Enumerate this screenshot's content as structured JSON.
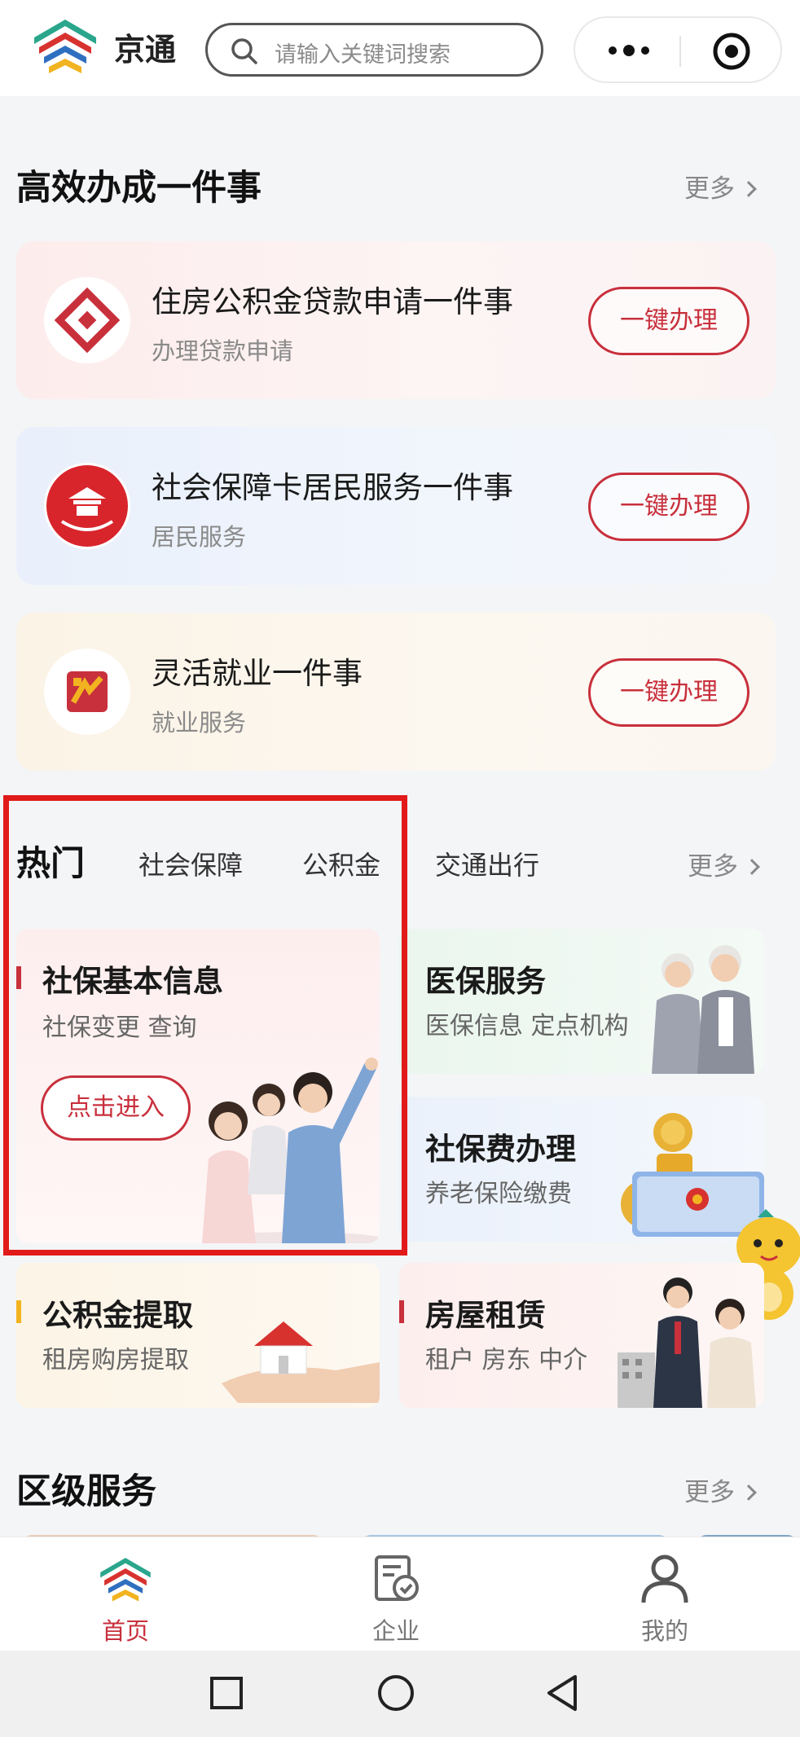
{
  "header": {
    "app_name": "京通",
    "search_placeholder": "请输入关键词搜索"
  },
  "one_thing": {
    "title": "高效办成一件事",
    "more": "更多",
    "items": [
      {
        "title": "住房公积金贷款申请一件事",
        "subtitle": "办理贷款申请",
        "button": "一键办理",
        "icon": "housing-fund-logo-icon"
      },
      {
        "title": "社会保障卡居民服务一件事",
        "subtitle": "居民服务",
        "button": "一键办理",
        "icon": "beijing-social-security-logo-icon"
      },
      {
        "title": "灵活就业一件事",
        "subtitle": "就业服务",
        "button": "一键办理",
        "icon": "employment-logo-icon"
      }
    ]
  },
  "hot": {
    "tabs": [
      "热门",
      "社会保障",
      "公积金",
      "交通出行"
    ],
    "more": "更多",
    "tiles": {
      "social_basic": {
        "title": "社保基本信息",
        "subtitle": "社保变更  查询",
        "button": "点击进入"
      },
      "medical": {
        "title": "医保服务",
        "subtitle": "医保信息  定点机构"
      },
      "fee": {
        "title": "社保费办理",
        "subtitle": "养老保险缴费"
      },
      "fund_withdraw": {
        "title": "公积金提取",
        "subtitle": "租房购房提取"
      },
      "rental": {
        "title": "房屋租赁",
        "subtitle": "租户  房东  中介"
      }
    }
  },
  "district": {
    "title": "区级服务",
    "more": "更多"
  },
  "bottom_nav": [
    {
      "label": "首页",
      "active": true
    },
    {
      "label": "企业",
      "active": false
    },
    {
      "label": "我的",
      "active": false
    }
  ],
  "colors": {
    "brand_red": "#c8303c",
    "highlight_red": "#e11a1a"
  }
}
